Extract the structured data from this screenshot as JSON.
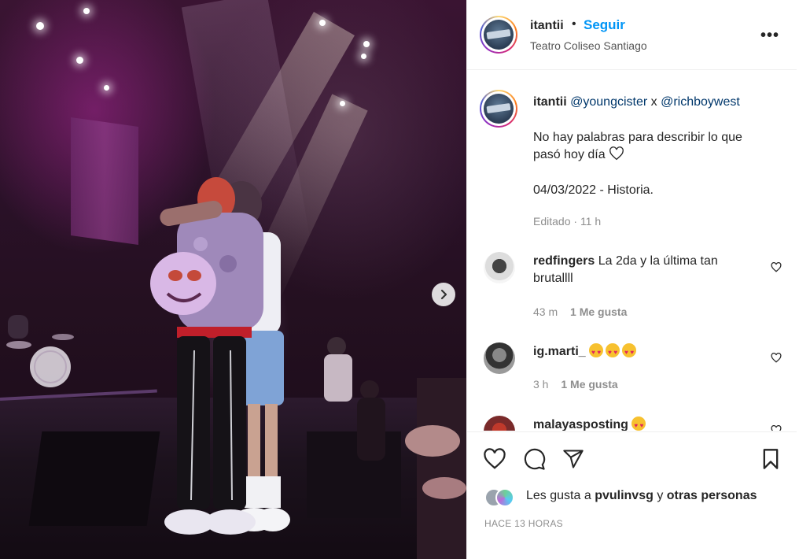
{
  "post": {
    "username": "itantii",
    "follow_label": "Seguir",
    "separator": "•",
    "location": "Teatro Coliseo Santiago",
    "more_label": "•••"
  },
  "caption": {
    "username": "itantii",
    "mention_1": "@youngcister",
    "connector": "x",
    "mention_2": "@richboywest",
    "line_1": "No hay palabras para describir lo que",
    "line_2": "pasó hoy día",
    "line_3": "04/03/2022 - Historia.",
    "edited": "Editado",
    "dot": "·",
    "time": "11 h"
  },
  "comments": [
    {
      "username": "redfingers",
      "text_1": "La 2da y la última tan",
      "text_2": "brutallll",
      "time": "43 m",
      "likes": "1 Me gusta"
    },
    {
      "username": "ig.marti_",
      "text_1": "",
      "time": "3 h",
      "likes": "1 Me gusta"
    },
    {
      "username": "malayasposting",
      "text_1": ""
    }
  ],
  "footer": {
    "likes_prefix": "Les gusta a",
    "liker": "pvulinvsg",
    "connector": "y",
    "others": "otras personas",
    "timestamp": "HACE 13 HORAS"
  },
  "icons": {
    "like": "heart-icon",
    "comment": "comment-icon",
    "share": "paper-plane-icon",
    "save": "bookmark-icon",
    "next": "chevron-right-icon"
  },
  "colors": {
    "follow_blue": "#0095f6",
    "mention_blue": "#00376b",
    "muted": "#8e8e8e"
  }
}
